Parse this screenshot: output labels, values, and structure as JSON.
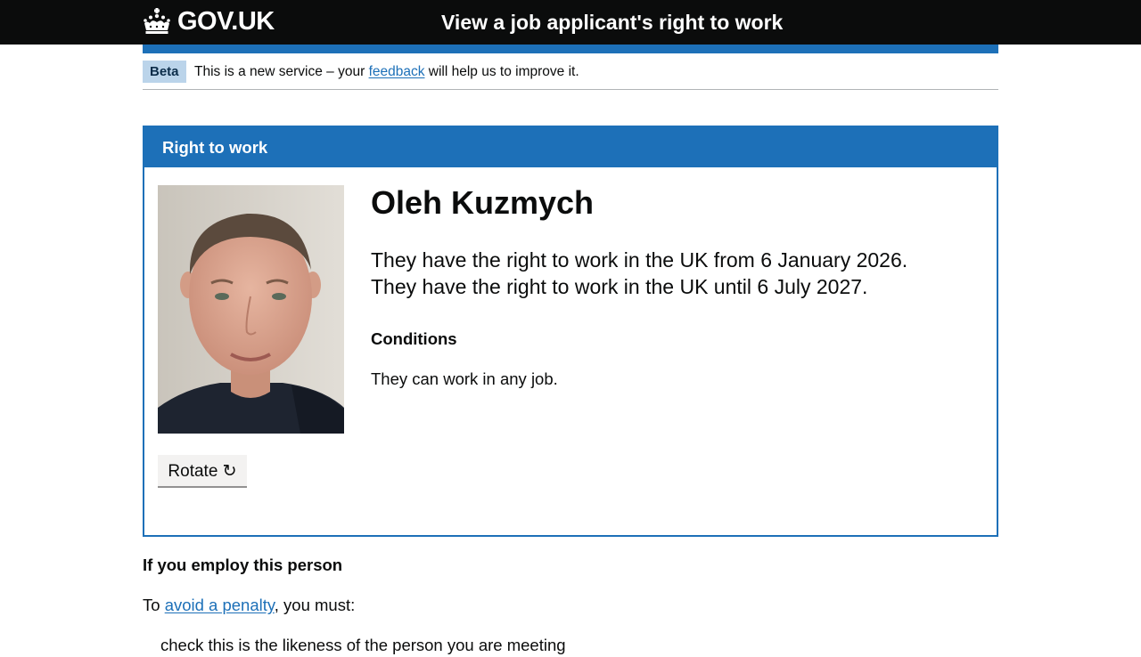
{
  "header": {
    "logo_text": "GOV.UK",
    "logo_icon": "crown-icon",
    "service_name": "View a job applicant's right to work"
  },
  "phase_banner": {
    "tag": "Beta",
    "text_before": "This is a new service – your",
    "link": "feedback",
    "text_after": "will help us to improve it."
  },
  "panel": {
    "title": "Right to work",
    "rotate_label": "Rotate ↻",
    "person_name": "Oleh Kuzmych",
    "rtw_from": "They have the right to work in the UK from 6 January 2026.",
    "rtw_until": "They have the right to work in the UK until 6 July 2027.",
    "conditions_heading": "Conditions",
    "conditions_text": "They can work in any job."
  },
  "employ": {
    "heading": "If you employ this person",
    "penalty_before": "To",
    "penalty_link": "avoid a penalty",
    "penalty_after": ", you must:",
    "list_first_fragment": "check this is the likeness of the person you are meeting"
  },
  "colors": {
    "header_bg": "#0b0c0c",
    "brand_blue": "#1d70b8",
    "tag_bg": "#bbd4ea",
    "text": "#0b0c0c"
  }
}
